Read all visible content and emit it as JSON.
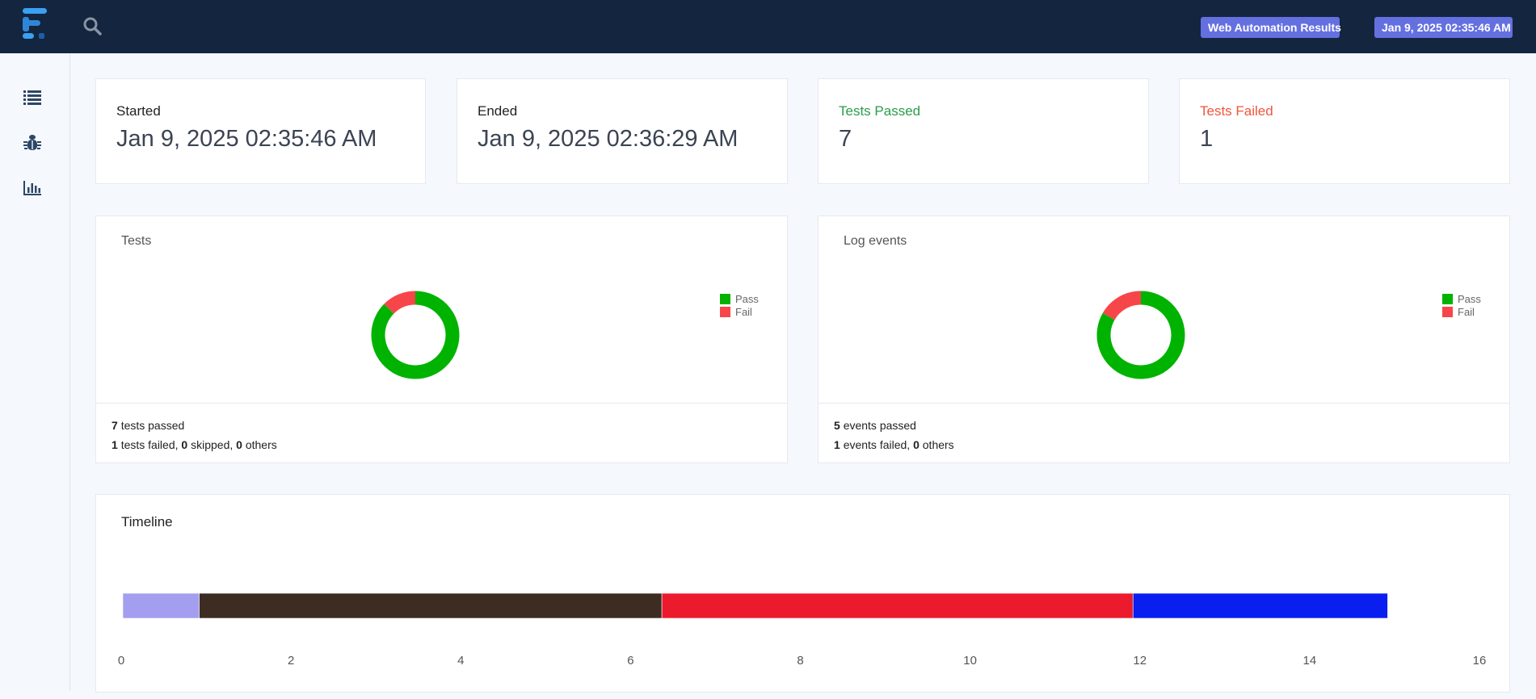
{
  "header": {
    "report_name": "Web Automation Results",
    "timestamp": "Jan 9, 2025 02:35:46 AM"
  },
  "sidebar": {
    "items": [
      {
        "icon": "list-icon"
      },
      {
        "icon": "bug-icon"
      },
      {
        "icon": "bar-chart-icon"
      }
    ]
  },
  "stats": {
    "started": {
      "label": "Started",
      "value": "Jan 9, 2025 02:35:46 AM"
    },
    "ended": {
      "label": "Ended",
      "value": "Jan 9, 2025 02:36:29 AM"
    },
    "passed": {
      "label": "Tests Passed",
      "value": "7"
    },
    "failed": {
      "label": "Tests Failed",
      "value": "1"
    }
  },
  "tests_panel": {
    "title": "Tests",
    "legend_pass": "Pass",
    "legend_fail": "Fail",
    "passed_count": "7",
    "passed_text": "tests passed",
    "failed_count": "1",
    "failed_text": "tests failed,",
    "skipped_count": "0",
    "skipped_text": "skipped,",
    "others_count": "0",
    "others_text": "others"
  },
  "events_panel": {
    "title": "Log events",
    "legend_pass": "Pass",
    "legend_fail": "Fail",
    "passed_count": "5",
    "passed_text": "events passed",
    "failed_count": "1",
    "failed_text": "events failed,",
    "others_count": "0",
    "others_text": "others"
  },
  "timeline": {
    "title": "Timeline"
  },
  "colors": {
    "pass": "#00b300",
    "fail": "#f7464a",
    "navy": "#13253f",
    "badge": "#6470e0"
  },
  "chart_data": [
    {
      "type": "pie",
      "title": "Tests",
      "donut": true,
      "categories": [
        "Pass",
        "Fail"
      ],
      "values": [
        7,
        1
      ],
      "colors": [
        "#00b300",
        "#f7464a"
      ],
      "legend": "right"
    },
    {
      "type": "pie",
      "title": "Log events",
      "donut": true,
      "categories": [
        "Pass",
        "Fail"
      ],
      "values": [
        5,
        1
      ],
      "colors": [
        "#00b300",
        "#f7464a"
      ],
      "legend": "right"
    },
    {
      "type": "bar",
      "orientation": "horizontal",
      "stacked": true,
      "title": "Timeline",
      "xlim": [
        0,
        16
      ],
      "xticks": [
        "0",
        "2",
        "4",
        "6",
        "8",
        "10",
        "12",
        "14",
        "16"
      ],
      "segments": [
        {
          "value": 0.9,
          "color": "#a39ef0"
        },
        {
          "value": 5.45,
          "color": "#3c2c22"
        },
        {
          "value": 5.55,
          "color": "#ec1a2d"
        },
        {
          "value": 3.0,
          "color": "#0b1ef0"
        }
      ],
      "grid": false
    }
  ]
}
